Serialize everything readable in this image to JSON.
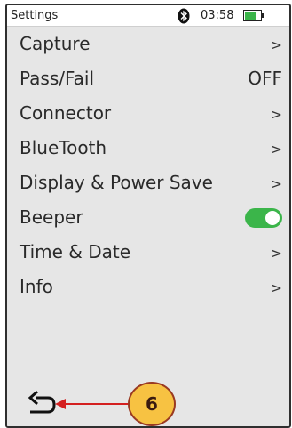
{
  "status_bar": {
    "title": "Settings",
    "time": "03:58",
    "bluetooth_icon": "bluetooth-icon",
    "battery_icon": "battery-icon",
    "battery_color": "#3bb54a"
  },
  "menu": {
    "items": [
      {
        "label": "Capture",
        "indicator": ">"
      },
      {
        "label": "Pass/Fail",
        "value": "OFF"
      },
      {
        "label": "Connector",
        "indicator": ">"
      },
      {
        "label": "BlueTooth",
        "indicator": ">"
      },
      {
        "label": "Display & Power Save",
        "indicator": ">"
      },
      {
        "label": "Beeper",
        "toggle": "on",
        "toggle_color": "#3bb54a"
      },
      {
        "label": "Time & Date",
        "indicator": ">"
      },
      {
        "label": "Info",
        "indicator": ">"
      }
    ]
  },
  "footer": {
    "back_icon": "back-arrow-icon",
    "callout_number": "6",
    "callout_color": "#f7c242",
    "arrow_color": "#d42020"
  }
}
